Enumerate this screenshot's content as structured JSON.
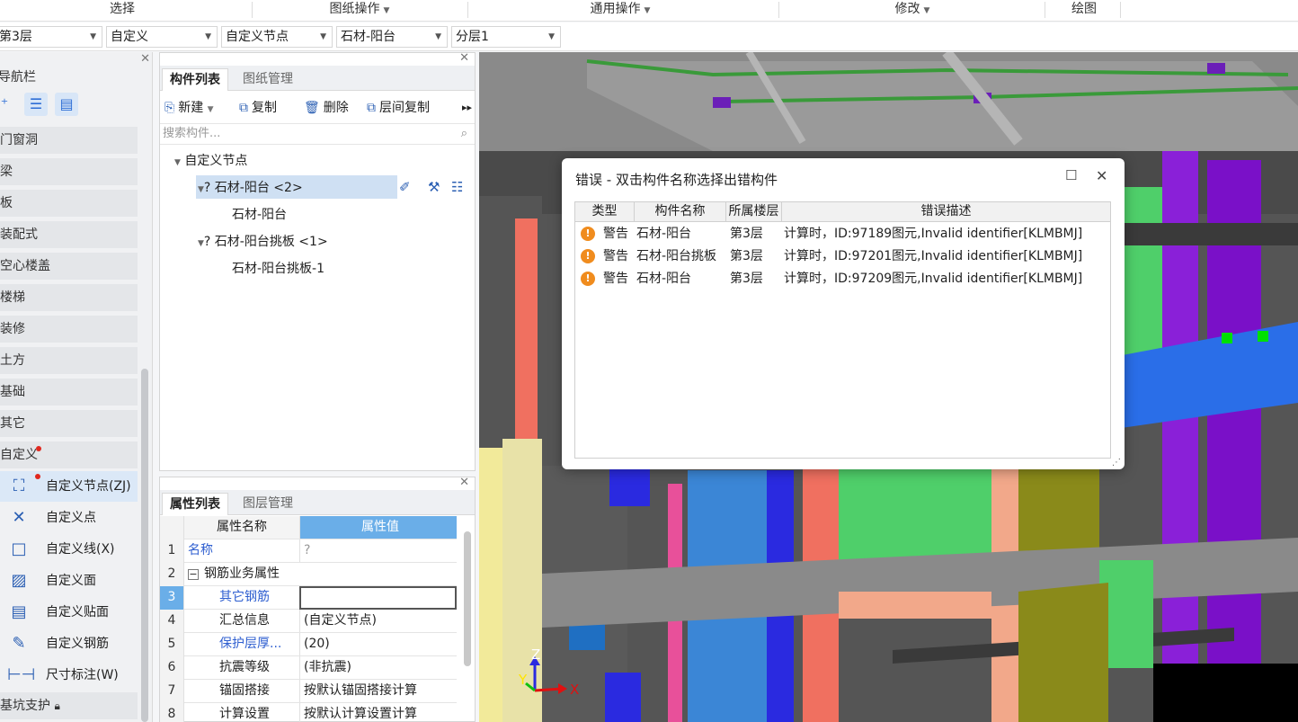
{
  "ribbon": {
    "groups": [
      "选择",
      "图纸操作",
      "通用操作",
      "修改",
      "绘图"
    ]
  },
  "selectors": {
    "floor": "第3层",
    "category": "自定义",
    "type": "自定义节点",
    "component": "石材-阳台",
    "layer": "分层1"
  },
  "nav": {
    "title": "导航栏",
    "categories": [
      "门窗洞",
      "梁",
      "板",
      "装配式",
      "空心楼盖",
      "楼梯",
      "装修",
      "土方",
      "基础",
      "其它",
      "自定义"
    ],
    "sub_items": [
      {
        "icon": "custom-node-icon",
        "label": "自定义节点(ZJ)"
      },
      {
        "icon": "custom-point-icon",
        "label": "自定义点"
      },
      {
        "icon": "custom-line-icon",
        "label": "自定义线(X)"
      },
      {
        "icon": "custom-area-icon",
        "label": "自定义面"
      },
      {
        "icon": "custom-patch-icon",
        "label": "自定义贴面"
      },
      {
        "icon": "custom-rebar-icon",
        "label": "自定义钢筋"
      },
      {
        "icon": "dimension-icon",
        "label": "尺寸标注(W)"
      }
    ],
    "bottom_category": "基坑支护"
  },
  "component_panel": {
    "tabs": [
      "构件列表",
      "图纸管理"
    ],
    "toolbar": [
      "新建",
      "复制",
      "删除",
      "层间复制"
    ],
    "search_placeholder": "搜索构件...",
    "tree": {
      "root": "自定义节点",
      "groups": [
        {
          "label": "? 石材-阳台 <2>",
          "children": [
            "石材-阳台"
          ]
        },
        {
          "label": "? 石材-阳台挑板 <1>",
          "children": [
            "石材-阳台挑板-1"
          ]
        }
      ]
    }
  },
  "property_panel": {
    "tabs": [
      "属性列表",
      "图层管理"
    ],
    "columns": [
      "属性名称",
      "属性值"
    ],
    "rows": [
      {
        "num": "1",
        "name": "名称",
        "value": "?"
      },
      {
        "num": "2",
        "name": "钢筋业务属性",
        "value": ""
      },
      {
        "num": "3",
        "name": "其它钢筋",
        "value": ""
      },
      {
        "num": "4",
        "name": "汇总信息",
        "value": "(自定义节点)"
      },
      {
        "num": "5",
        "name": "保护层厚...",
        "value": "(20)"
      },
      {
        "num": "6",
        "name": "抗震等级",
        "value": "(非抗震)"
      },
      {
        "num": "7",
        "name": "锚固搭接",
        "value": "按默认锚固搭接计算"
      },
      {
        "num": "8",
        "name": "计算设置",
        "value": "按默认计算设置计算"
      }
    ]
  },
  "dialog": {
    "title": "错误 - 双击构件名称选择出错构件",
    "columns": [
      "类型",
      "构件名称",
      "所属楼层",
      "错误描述"
    ],
    "rows": [
      {
        "type": "警告",
        "name": "石材-阳台",
        "floor": "第3层",
        "desc": "计算时，ID:97189图元,Invalid identifier[KLMBMJ]"
      },
      {
        "type": "警告",
        "name": "石材-阳台挑板",
        "floor": "第3层",
        "desc": "计算时，ID:97201图元,Invalid identifier[KLMBMJ]"
      },
      {
        "type": "警告",
        "name": "石材-阳台",
        "floor": "第3层",
        "desc": "计算时，ID:97209图元,Invalid identifier[KLMBMJ]"
      }
    ]
  },
  "axes": {
    "z": "Z",
    "y": "Y",
    "x": "X"
  },
  "colors": {
    "accent": "#2f6fd6",
    "warning": "#f08c1e",
    "selected_row": "#cfe0f3",
    "prop_header": "#6aaee8"
  }
}
